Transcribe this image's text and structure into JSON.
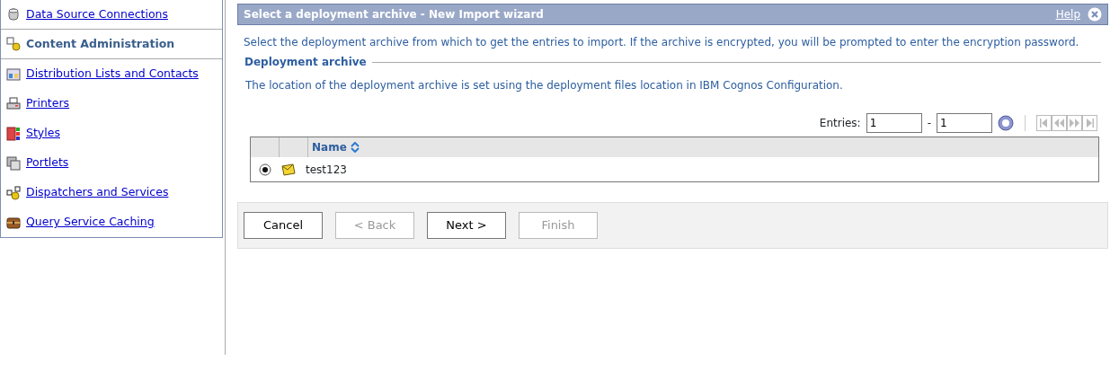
{
  "sidebar": {
    "items": [
      {
        "label": "Data Source Connections",
        "selected": false
      },
      {
        "label": "Content Administration",
        "selected": true
      },
      {
        "label": "Distribution Lists and Contacts",
        "selected": false
      },
      {
        "label": "Printers",
        "selected": false
      },
      {
        "label": "Styles",
        "selected": false
      },
      {
        "label": "Portlets",
        "selected": false
      },
      {
        "label": "Dispatchers and Services",
        "selected": false
      },
      {
        "label": "Query Service Caching",
        "selected": false
      }
    ]
  },
  "wizard": {
    "title": "Select a deployment archive - New Import wizard",
    "help": "Help",
    "intro": "Select the deployment archive from which to get the entries to import. If the archive is encrypted, you will be prompted to enter the encryption password.",
    "section": "Deployment archive",
    "location_note": "The location of the deployment archive is set using the deployment files location in IBM Cognos Configuration.",
    "pager": {
      "label": "Entries:",
      "from": "1",
      "separator": "-",
      "to": "1"
    },
    "table": {
      "columns": [
        "Name"
      ],
      "rows": [
        {
          "name": "test123",
          "selected": true
        }
      ]
    },
    "buttons": [
      {
        "label": "Cancel",
        "disabled": false
      },
      {
        "label": "< Back",
        "disabled": true
      },
      {
        "label": "Next >",
        "disabled": false
      },
      {
        "label": "Finish",
        "disabled": true
      }
    ]
  }
}
